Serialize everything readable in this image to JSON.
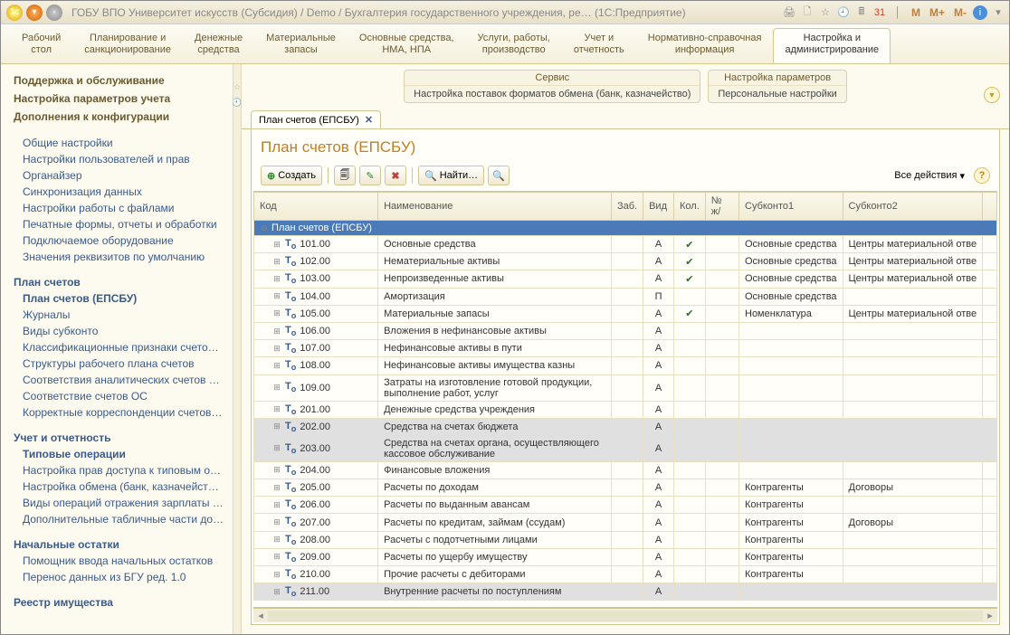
{
  "titlebar": {
    "title": "ГОБУ ВПО Университет искусств (Субсидия) / Demo / Бухгалтерия государственного учреждения, ре…  (1С:Предприятие)",
    "m1": "M",
    "m2": "M+",
    "m3": "M-"
  },
  "navTabs": [
    {
      "l1": "Рабочий",
      "l2": "стол"
    },
    {
      "l1": "Планирование и",
      "l2": "санкционирование"
    },
    {
      "l1": "Денежные",
      "l2": "средства"
    },
    {
      "l1": "Материальные",
      "l2": "запасы"
    },
    {
      "l1": "Основные средства,",
      "l2": "НМА, НПА"
    },
    {
      "l1": "Услуги, работы,",
      "l2": "производство"
    },
    {
      "l1": "Учет и",
      "l2": "отчетность"
    },
    {
      "l1": "Нормативно-справочная",
      "l2": "информация"
    },
    {
      "l1": "Настройка и",
      "l2": "администрирование",
      "active": true
    }
  ],
  "sidebar": {
    "s1": "Поддержка и обслуживание",
    "s2": "Настройка параметров учета",
    "s3": "Дополнения к конфигурации",
    "g1": [
      "Общие настройки",
      "Настройки пользователей и прав",
      "Органайзер",
      "Синхронизация данных",
      "Настройки работы с файлами",
      "Печатные формы, отчеты и обработки",
      "Подключаемое оборудование",
      "Значения реквизитов по умолчанию"
    ],
    "h2": "План счетов",
    "g2": [
      "План счетов (ЕПСБУ)",
      "Журналы",
      "Виды субконто",
      "Классификационные признаки счето…",
      "Структуры рабочего плана счетов",
      "Соответствия аналитических счетов …",
      "Соответствие счетов ОС",
      "Корректные корреспонденции счетов…"
    ],
    "h3": "Учет и отчетность",
    "g3": [
      "Типовые операции",
      "Настройка прав доступа к типовым о…",
      "Настройка обмена (банк, казначейст…",
      "Виды операций отражения зарплаты …",
      "Дополнительные табличные части до…"
    ],
    "h4": "Начальные остатки",
    "g4": [
      "Помощник ввода начальных остатков",
      "Перенос данных из БГУ ред. 1.0"
    ],
    "h5": "Реестр имущества"
  },
  "service": {
    "left_h": "Сервис",
    "left_b": "Настройка поставок форматов обмена (банк, казначейство)",
    "right_h": "Настройка параметров",
    "right_b": "Персональные настройки"
  },
  "docTab": "План счетов (ЕПСБУ)",
  "docTitle": "План счетов (ЕПСБУ)",
  "toolbar": {
    "create": "Создать",
    "find": "Найти…",
    "all_actions": "Все действия"
  },
  "columns": [
    "Код",
    "Наименование",
    "Заб.",
    "Вид",
    "Кол.",
    "№ ж/",
    "Субконто1",
    "Субконто2"
  ],
  "headerRow": "План счетов (ЕПСБУ)",
  "rows": [
    {
      "code": "101.00",
      "name": "Основные средства",
      "vid": "А",
      "kol": true,
      "s1": "Основные средства",
      "s2": "Центры материальной отве"
    },
    {
      "code": "102.00",
      "name": "Нематериальные активы",
      "vid": "А",
      "kol": true,
      "s1": "Основные средства",
      "s2": "Центры материальной отве"
    },
    {
      "code": "103.00",
      "name": "Непроизведенные активы",
      "vid": "А",
      "kol": true,
      "s1": "Основные средства",
      "s2": "Центры материальной отве"
    },
    {
      "code": "104.00",
      "name": "Амортизация",
      "vid": "П",
      "s1": "Основные средства"
    },
    {
      "code": "105.00",
      "name": "Материальные запасы",
      "vid": "А",
      "kol": true,
      "s1": "Номенклатура",
      "s2": "Центры материальной отве"
    },
    {
      "code": "106.00",
      "name": "Вложения в нефинансовые активы",
      "vid": "А"
    },
    {
      "code": "107.00",
      "name": "Нефинансовые активы в пути",
      "vid": "А"
    },
    {
      "code": "108.00",
      "name": "Нефинансовые активы имущества казны",
      "vid": "А"
    },
    {
      "code": "109.00",
      "name": "Затраты на изготовление готовой продукции, выполнение работ, услуг",
      "vid": "А",
      "wrap": true
    },
    {
      "code": "201.00",
      "name": "Денежные средства учреждения",
      "vid": "А"
    },
    {
      "code": "202.00",
      "name": "Средства на счетах бюджета",
      "vid": "А",
      "gray": true
    },
    {
      "code": "203.00",
      "name": "Средства на счетах органа, осуществляющего кассовое обслуживание",
      "vid": "А",
      "gray": true,
      "wrap": true
    },
    {
      "code": "204.00",
      "name": "Финансовые вложения",
      "vid": "А"
    },
    {
      "code": "205.00",
      "name": "Расчеты по доходам",
      "vid": "А",
      "s1": "Контрагенты",
      "s2": "Договоры"
    },
    {
      "code": "206.00",
      "name": "Расчеты по выданным авансам",
      "vid": "А",
      "s1": "Контрагенты"
    },
    {
      "code": "207.00",
      "name": "Расчеты по кредитам, займам (ссудам)",
      "vid": "А",
      "s1": "Контрагенты",
      "s2": "Договоры"
    },
    {
      "code": "208.00",
      "name": "Расчеты с подотчетными лицами",
      "vid": "А",
      "s1": "Контрагенты"
    },
    {
      "code": "209.00",
      "name": "Расчеты по ущербу имуществу",
      "vid": "А",
      "s1": "Контрагенты"
    },
    {
      "code": "210.00",
      "name": "Прочие расчеты с дебиторами",
      "vid": "А",
      "s1": "Контрагенты"
    },
    {
      "code": "211.00",
      "name": "Внутренние расчеты по поступлениям",
      "vid": "А",
      "gray": true
    }
  ]
}
